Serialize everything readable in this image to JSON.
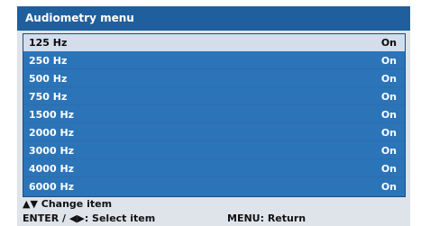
{
  "title": "Audiometry menu",
  "items": [
    {
      "label": "125 Hz",
      "value": "On",
      "selected": true
    },
    {
      "label": "250 Hz",
      "value": "On",
      "selected": false
    },
    {
      "label": "500 Hz",
      "value": "On",
      "selected": false
    },
    {
      "label": "750 Hz",
      "value": "On",
      "selected": false
    },
    {
      "label": "1500 Hz",
      "value": "On",
      "selected": false
    },
    {
      "label": "2000 Hz",
      "value": "On",
      "selected": false
    },
    {
      "label": "3000 Hz",
      "value": "On",
      "selected": false
    },
    {
      "label": "4000 Hz",
      "value": "On",
      "selected": false
    },
    {
      "label": "6000 Hz",
      "value": "On",
      "selected": false
    }
  ],
  "footer": {
    "change_glyph": "▲▼",
    "change_text": "Change item",
    "select_glyph": "ENTER / ◀▶",
    "select_text": ": Select item",
    "menu_text": "MENU: Return"
  },
  "colors": {
    "title_bar": "#1f5f9e",
    "list_bg": "#2b74b8",
    "selected_row": "#d4dde9",
    "screen_bg": "#dfe3ea"
  }
}
